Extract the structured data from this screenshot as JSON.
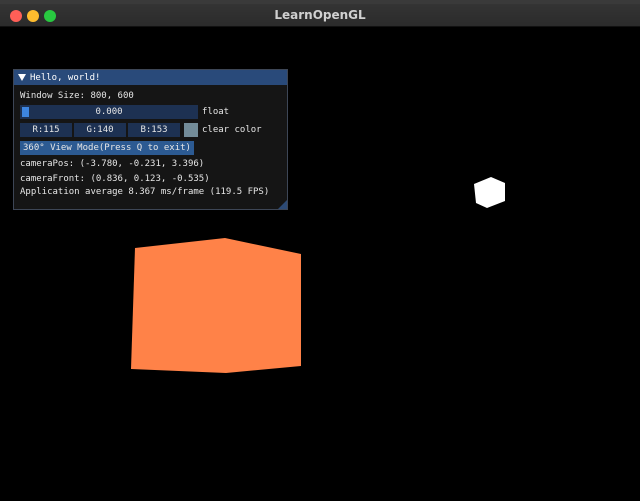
{
  "window": {
    "title": "LearnOpenGL"
  },
  "imgui": {
    "title": "Hello, world!",
    "window_size": "Window Size: 800, 600",
    "slider_value": "0.000",
    "slider_label": "float",
    "color_r": "R:115",
    "color_g": "G:140",
    "color_b": "B:153",
    "color_label": "clear color",
    "color_swatch": "#738c99",
    "view_mode_button": "360° View Mode(Press Q to exit)",
    "camera_pos": "cameraPos: (-3.780, -0.231, 3.396)",
    "camera_front": "cameraFront: (0.836, 0.123, -0.535)",
    "app_average": "Application average 8.367 ms/frame (119.5 FPS)"
  },
  "scene": {
    "cube_color": "#ff8248",
    "light_color": "#ffffff"
  }
}
